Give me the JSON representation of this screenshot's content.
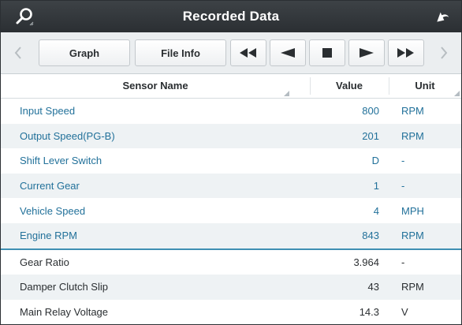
{
  "header": {
    "title": "Recorded Data",
    "left_icon": "search-icon",
    "right_icon": "back-arrow-icon"
  },
  "toolbar": {
    "prev_page_icon": "chevron-left-icon",
    "graph_label": "Graph",
    "file_info_label": "File Info",
    "rewind_icon": "rewind-icon",
    "step_back_icon": "step-back-icon",
    "stop_icon": "stop-icon",
    "play_icon": "play-icon",
    "fast_forward_icon": "fast-forward-icon",
    "next_page_icon": "chevron-right-icon"
  },
  "table": {
    "columns": {
      "name": "Sensor Name",
      "value": "Value",
      "unit": "Unit"
    },
    "rows": [
      {
        "name": "Input Speed",
        "value": "800",
        "unit": "RPM"
      },
      {
        "name": "Output Speed(PG-B)",
        "value": "201",
        "unit": "RPM"
      },
      {
        "name": "Shift Lever Switch",
        "value": "D",
        "unit": "-"
      },
      {
        "name": "Current Gear",
        "value": "1",
        "unit": "-"
      },
      {
        "name": "Vehicle Speed",
        "value": "4",
        "unit": "MPH"
      },
      {
        "name": "Engine RPM",
        "value": "843",
        "unit": "RPM"
      },
      {
        "name": "Gear Ratio",
        "value": "3.964",
        "unit": "-"
      },
      {
        "name": "Damper Clutch Slip",
        "value": "43",
        "unit": "RPM"
      },
      {
        "name": "Main Relay Voltage",
        "value": "14.3",
        "unit": "V"
      }
    ]
  },
  "colors": {
    "title_bar": "#2b2f33",
    "recorded_text": "#22719a",
    "plain_text": "#2a2e31",
    "separator": "#3f8fb3"
  }
}
